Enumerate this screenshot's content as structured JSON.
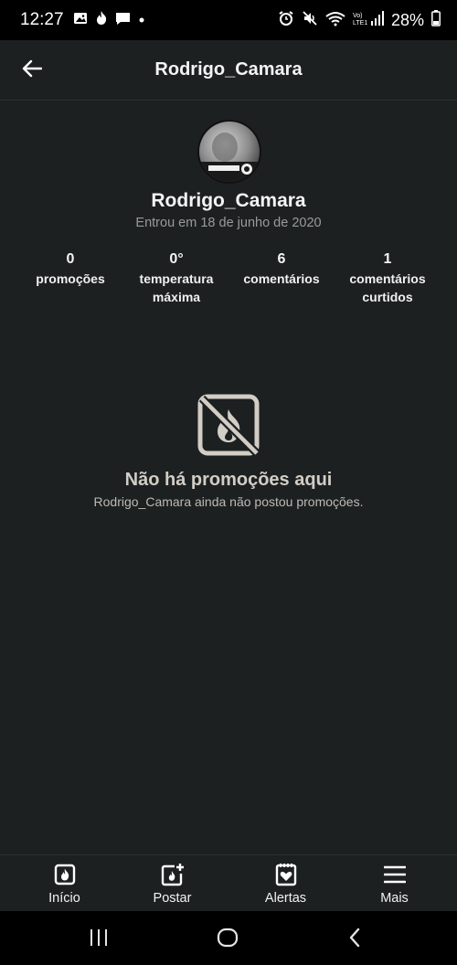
{
  "status_bar": {
    "time": "12:27",
    "battery": "28%",
    "left_icons": [
      "gallery-icon",
      "flame-icon",
      "message-icon",
      "dot-icon"
    ],
    "right_icons": [
      "alarm-icon",
      "mute-icon",
      "wifi-icon",
      "lte-signal-icon"
    ]
  },
  "header": {
    "title": "Rodrigo_Camara",
    "back_icon": "arrow-left-icon"
  },
  "profile": {
    "name": "Rodrigo_Camara",
    "joined": "Entrou em 18 de junho de 2020",
    "stats": [
      {
        "value": "0",
        "label_line1": "promoções",
        "label_line2": ""
      },
      {
        "value": "0°",
        "label_line1": "temperatura",
        "label_line2": "máxima"
      },
      {
        "value": "6",
        "label_line1": "comentários",
        "label_line2": ""
      },
      {
        "value": "1",
        "label_line1": "comentários",
        "label_line2": "curtidos"
      }
    ]
  },
  "empty_state": {
    "icon": "no-promotions-icon",
    "title": "Não há promoções aqui",
    "subtitle": "Rodrigo_Camara ainda não postou promoções."
  },
  "bottom_nav": [
    {
      "label": "Início",
      "icon": "home-flame-icon"
    },
    {
      "label": "Postar",
      "icon": "post-add-icon"
    },
    {
      "label": "Alertas",
      "icon": "alerts-icon"
    },
    {
      "label": "Mais",
      "icon": "menu-icon"
    }
  ],
  "colors": {
    "background": "#1d2021",
    "status_bar": "#000000",
    "empty_state": "#d2cdc5",
    "muted_text": "#9a9a9a"
  }
}
